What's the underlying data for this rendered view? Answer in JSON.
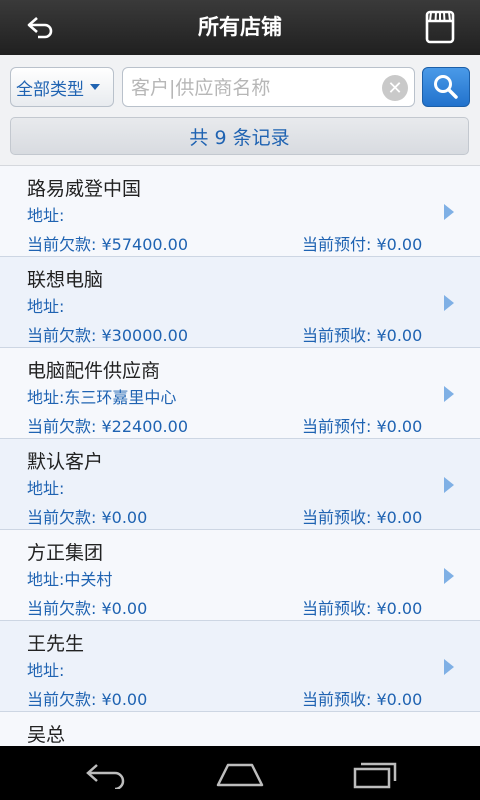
{
  "header": {
    "title": "所有店铺"
  },
  "filter": {
    "type_label": "全部类型",
    "search_placeholder": "客户|供应商名称",
    "search_value": "",
    "record_count": "共 9 条记录"
  },
  "records": [
    {
      "name": "路易威登中国",
      "address": "地址:",
      "debt": "当前欠款: ¥57400.00",
      "prepay": "当前预付: ¥0.00"
    },
    {
      "name": "联想电脑",
      "address": "地址:",
      "debt": "当前欠款: ¥30000.00",
      "prepay": "当前预收: ¥0.00"
    },
    {
      "name": "电脑配件供应商",
      "address": "地址:东三环嘉里中心",
      "debt": "当前欠款: ¥22400.00",
      "prepay": "当前预付: ¥0.00"
    },
    {
      "name": "默认客户",
      "address": "地址:",
      "debt": "当前欠款: ¥0.00",
      "prepay": "当前预收: ¥0.00"
    },
    {
      "name": "方正集团",
      "address": "地址:中关村",
      "debt": "当前欠款: ¥0.00",
      "prepay": "当前预收: ¥0.00"
    },
    {
      "name": "王先生",
      "address": "地址:",
      "debt": "当前欠款: ¥0.00",
      "prepay": "当前预收: ¥0.00"
    },
    {
      "name": "吴总",
      "address": "",
      "debt": "",
      "prepay": ""
    }
  ],
  "colors": {
    "accent": "#1f63b2",
    "topbar": "#2a2a2a",
    "arrow": "#7fb0e5"
  },
  "icons": {
    "back": "back-arrow-icon",
    "store": "store-icon",
    "clear": "clear-icon",
    "search": "search-icon",
    "nav_back": "nav-back-icon",
    "nav_home": "nav-home-icon",
    "nav_recent": "nav-recent-apps-icon"
  }
}
